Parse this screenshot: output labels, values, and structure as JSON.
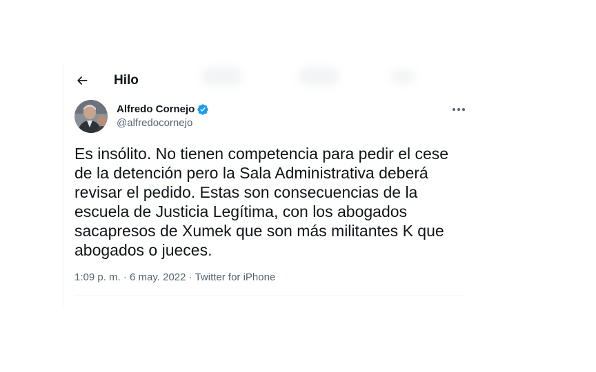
{
  "header": {
    "back_icon": "arrow-left-icon",
    "title": "Hilo"
  },
  "tweet": {
    "author": {
      "display_name": "Alfredo Cornejo",
      "handle": "@alfredocornejo",
      "verified_icon": "verified-badge-icon",
      "verified_color": "#1d9bf0"
    },
    "more_icon": "more-horizontal-icon",
    "text_lines": [
      "Es insólito. No tienen competencia para pedir el cese",
      "de la detención pero la Sala Administrativa deberá",
      "revisar el pedido. Estas son consecuencias de la",
      "escuela de Justicia Legítima, con los abogados",
      "sacapresos de Xumek que son más militantes K que",
      "abogados o jueces."
    ],
    "time": "1:09 p. m.",
    "separator": "·",
    "date": "6 may. 2022",
    "source": "Twitter for iPhone"
  },
  "colors": {
    "text_primary": "#0f1419",
    "text_secondary": "#536471",
    "divider": "#eff3f4",
    "accent": "#1d9bf0"
  }
}
